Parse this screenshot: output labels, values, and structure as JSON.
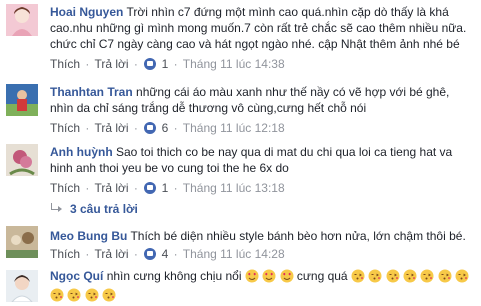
{
  "comments": [
    {
      "author": "Hoai Nguyen",
      "text": "Trời nhìn c7 đứng một mình cao quá.nhìn cặp dò thấy là khá cao.nhu những gì mình mong muốn.7 còn rất trẻ chắc sẽ cao thêm nhiều nữa. chức chỉ C7 ngày càng cao và hát ngọt ngào nhé. cập Nhật thêm ảnh nhé bé",
      "like_label": "Thích",
      "reply_label": "Trả lời",
      "likes": "1",
      "time": "Tháng 11 lúc 14:38"
    },
    {
      "author": "Thanhtan Tran",
      "text": "những cái áo màu xanh như thế nầy có vẽ hợp với bé ghê, nhìn da chỉ sáng trắng dễ thương vô cùng,cưng hết chỗ nói",
      "like_label": "Thích",
      "reply_label": "Trả lời",
      "likes": "6",
      "time": "Tháng 11 lúc 12:18"
    },
    {
      "author": "Anh huỳnh",
      "text": "Sao toi thich co be nay qua di mat du chi qua loi ca tieng hat va hinh anh thoi yeu be vo cung toi the he 6x do",
      "like_label": "Thích",
      "reply_label": "Trả lời",
      "likes": "1",
      "time": "Tháng 11 lúc 13:18",
      "replies_label": "3 câu trả lời"
    },
    {
      "author": "Meo Bung Bu",
      "text": "Thích bé diện nhiều style bánh bèo hơn nửa, lớn chậm thôi bé.",
      "like_label": "Thích",
      "reply_label": "Trả lời",
      "likes": "4",
      "time": "Tháng 11 lúc 14:28"
    },
    {
      "author": "Ngọc Quí",
      "text_before": "nhìn cưng không chịu nổi",
      "text_middle": "cưng quá"
    }
  ],
  "icons": {
    "like_badge": "like-thumb-icon",
    "reply_arrow": "reply-arrow-icon",
    "heart_eyes": "heart-eyes-emoji",
    "kiss": "blowing-kiss-emoji"
  },
  "colors": {
    "author": "#365899",
    "meta": "#90949c",
    "like_blue": "#4267b2",
    "text": "#1d2129"
  }
}
